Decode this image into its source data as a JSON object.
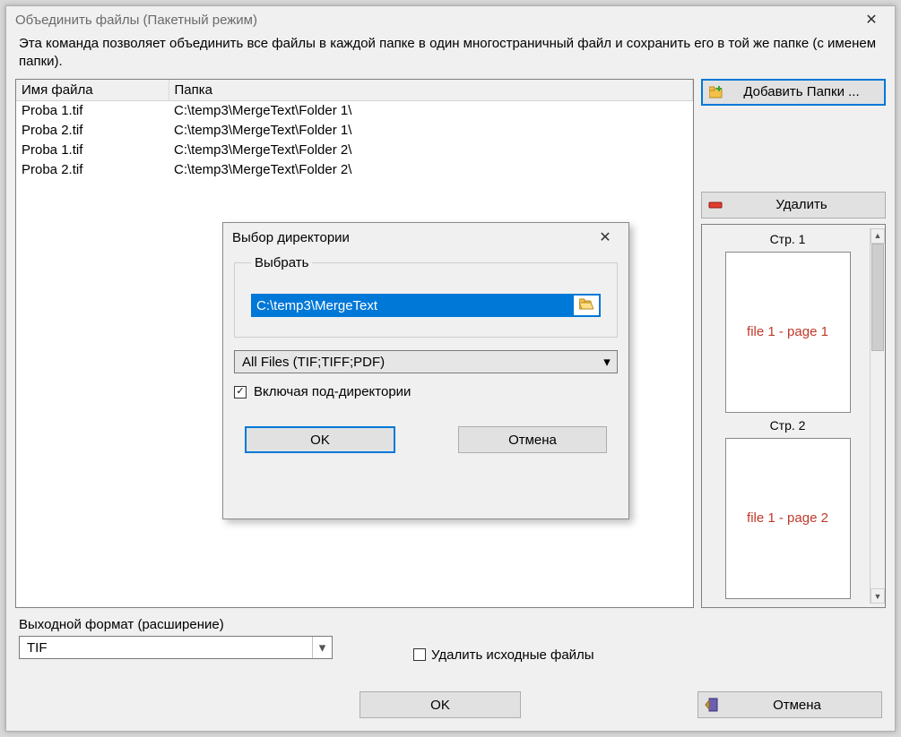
{
  "main": {
    "title": "Объединить файлы (Пакетный режим)",
    "description": "Эта команда позволяет объединить все файлы в каждой папке в один многостраничный файл и сохранить его в той же папке (с именем папки).",
    "table": {
      "headers": {
        "name": "Имя файла",
        "folder": "Папка"
      },
      "rows": [
        {
          "name": "Proba 1.tif",
          "folder": "C:\\temp3\\MergeText\\Folder 1\\"
        },
        {
          "name": "Proba 2.tif",
          "folder": "C:\\temp3\\MergeText\\Folder 1\\"
        },
        {
          "name": "Proba 1.tif",
          "folder": "C:\\temp3\\MergeText\\Folder 2\\"
        },
        {
          "name": "Proba 2.tif",
          "folder": "C:\\temp3\\MergeText\\Folder 2\\"
        }
      ]
    },
    "buttons": {
      "add_folders": "Добавить Папки ...",
      "delete": "Удалить",
      "ok": "OK",
      "cancel": "Отмена"
    },
    "preview": {
      "pages": [
        {
          "title": "Стр. 1",
          "text": "file 1 - page 1"
        },
        {
          "title": "Стр. 2",
          "text": "file 1 - page 2"
        }
      ]
    },
    "format": {
      "label": "Выходной формат (расширение)",
      "value": "TIF",
      "delete_source_label": "Удалить исходные файлы",
      "delete_source_checked": false
    }
  },
  "inner": {
    "title": "Выбор директории",
    "legend": "Выбрать",
    "path": "C:\\temp3\\MergeText",
    "filetype": "All Files (TIF;TIFF;PDF)",
    "subdirs_label": "Включая под-директории",
    "subdirs_checked": true,
    "ok": "OK",
    "cancel": "Отмена"
  }
}
